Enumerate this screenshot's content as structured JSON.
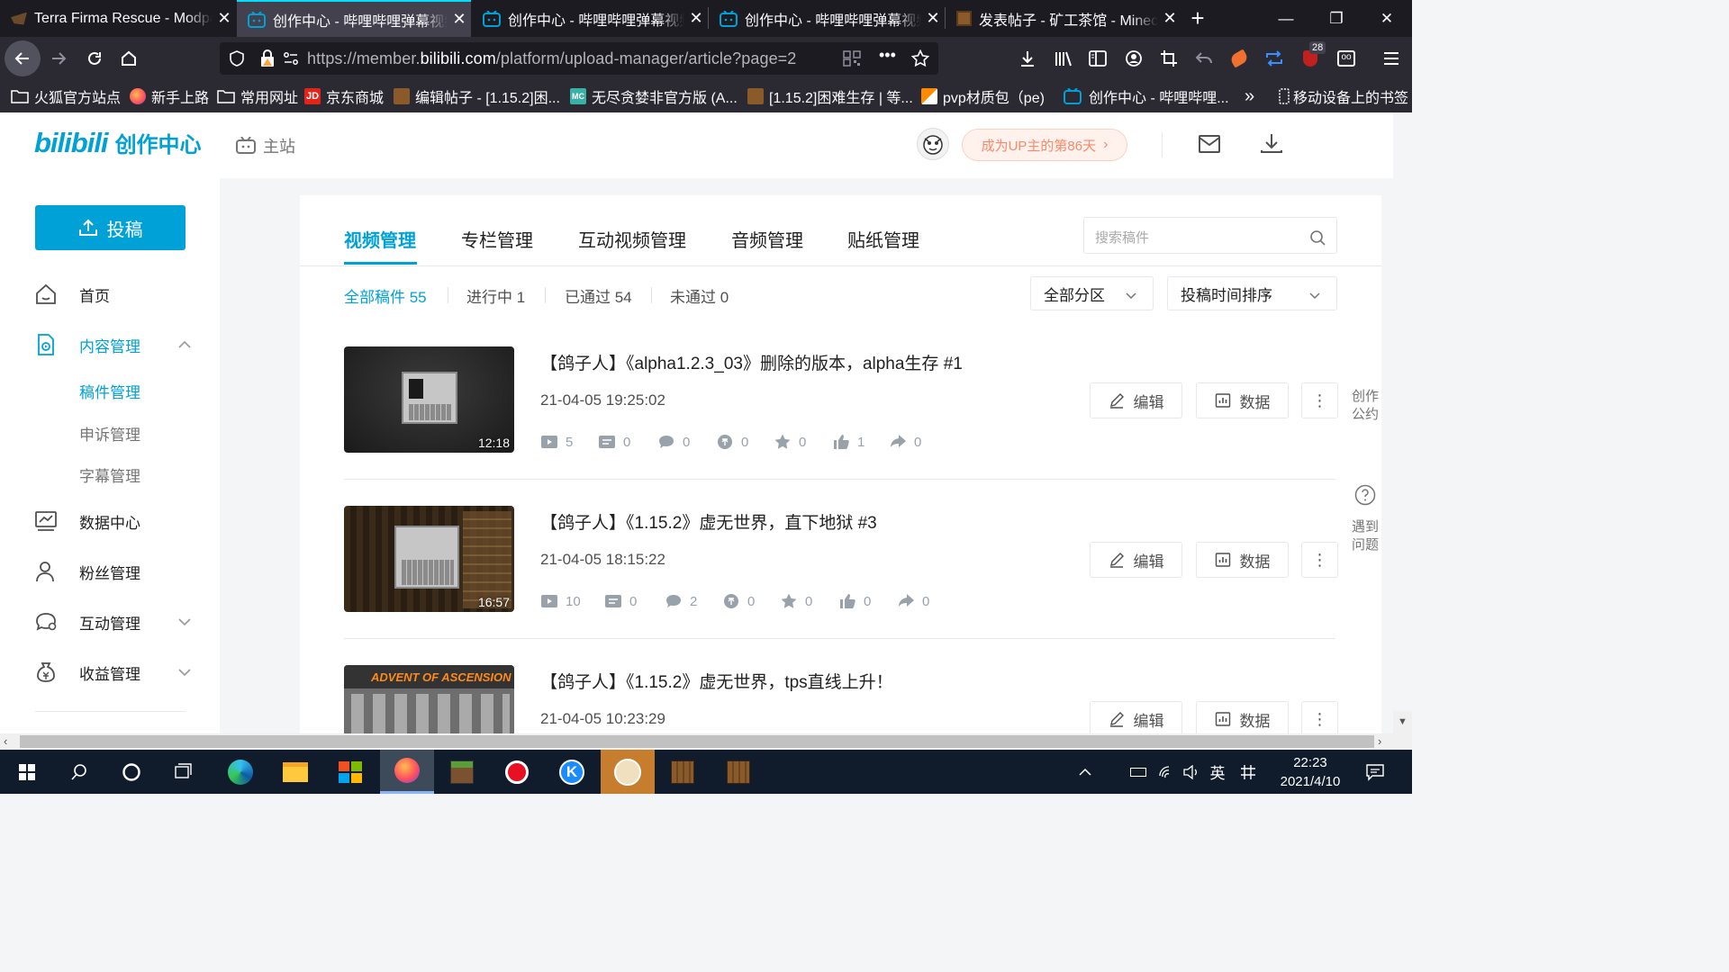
{
  "browser": {
    "tabs": [
      {
        "title": "Terra Firma Rescue - Modpack",
        "active": false
      },
      {
        "title": "创作中心 - 哔哩哔哩弹幕视频网",
        "active": true
      },
      {
        "title": "创作中心 - 哔哩哔哩弹幕视频网",
        "active": false
      },
      {
        "title": "创作中心 - 哔哩哔哩弹幕视频网",
        "active": false
      },
      {
        "title": "发表帖子 - 矿工茶馆 - Minecraft",
        "active": false
      }
    ],
    "new_tab": "+",
    "url_prefix": "https://member.",
    "url_domain": "bilibili.com",
    "url_path": "/platform/upload-manager/article?page=2",
    "url_more": "•••",
    "notif_badge": "28",
    "bookmarks": [
      {
        "label": "火狐官方站点",
        "icon": "folder-icon"
      },
      {
        "label": "新手上路",
        "icon": "firefox-icon"
      },
      {
        "label": "常用网址",
        "icon": "folder-icon"
      },
      {
        "label": "京东商城",
        "icon": "jd-icon"
      },
      {
        "label": "编辑帖子 - [1.15.2]困...",
        "icon": "block-icon"
      },
      {
        "label": "无尽贪婪非官方版 (A...",
        "icon": "mc-icon"
      },
      {
        "label": "[1.15.2]困难生存 | 等...",
        "icon": "block-icon"
      },
      {
        "label": "pvp材质包（pe)",
        "icon": "pvp-icon"
      },
      {
        "label": "创作中心 - 哔哩哔哩...",
        "icon": "bilibili-icon"
      }
    ],
    "bookmarks_overflow": "»",
    "mobile_bookmarks": "移动设备上的书签"
  },
  "header": {
    "logo_text": "bilibili",
    "logo_suffix": "创作中心",
    "home_link": "主站",
    "up_days": "成为UP主的第86天"
  },
  "sidebar": {
    "upload_button": "投稿",
    "items": [
      {
        "label": "首页"
      },
      {
        "label": "内容管理"
      },
      {
        "label": "数据中心"
      },
      {
        "label": "粉丝管理"
      },
      {
        "label": "互动管理"
      },
      {
        "label": "收益管理"
      }
    ],
    "sub_items": [
      "稿件管理",
      "申诉管理",
      "字幕管理"
    ]
  },
  "main": {
    "tabs": [
      "视频管理",
      "专栏管理",
      "互动视频管理",
      "音频管理",
      "贴纸管理"
    ],
    "search_placeholder": "搜索稿件",
    "filters": [
      "全部稿件 55",
      "进行中 1",
      "已通过 54",
      "未通过 0"
    ],
    "zone_select": "全部分区",
    "sort_select": "投稿时间排序",
    "edit_label": "编辑",
    "data_label": "数据",
    "more_label": "⋮",
    "videos": [
      {
        "title": "【鸽子人】《alpha1.2.3_03》删除的版本，alpha生存 #1",
        "time": "21-04-05 19:25:02",
        "duration": "12:18",
        "stats": {
          "plays": "5",
          "danmaku": "0",
          "comments": "0",
          "coins": "0",
          "favorites": "0",
          "likes": "1",
          "shares": "0"
        }
      },
      {
        "title": "【鸽子人】《1.15.2》虚无世界，直下地狱 #3",
        "time": "21-04-05 18:15:22",
        "duration": "16:57",
        "stats": {
          "plays": "10",
          "danmaku": "0",
          "comments": "2",
          "coins": "0",
          "favorites": "0",
          "likes": "0",
          "shares": "0"
        }
      },
      {
        "title": "【鸽子人】《1.15.2》虚无世界，tps直线上升！",
        "time": "21-04-05 10:23:29",
        "duration": "",
        "thumb_text": "ADVENT OF ASCENSION",
        "stats": {}
      }
    ]
  },
  "right_float": {
    "convention": "创作公约",
    "help": "遇到问题"
  },
  "taskbar": {
    "ime": "英",
    "time": "22:23",
    "date": "2021/4/10"
  },
  "colors": {
    "accent": "#00a1d6",
    "tab_indicator": "#00ddff",
    "up_badge_bg": "#fff1ec",
    "up_badge_text": "#f58b6b"
  }
}
